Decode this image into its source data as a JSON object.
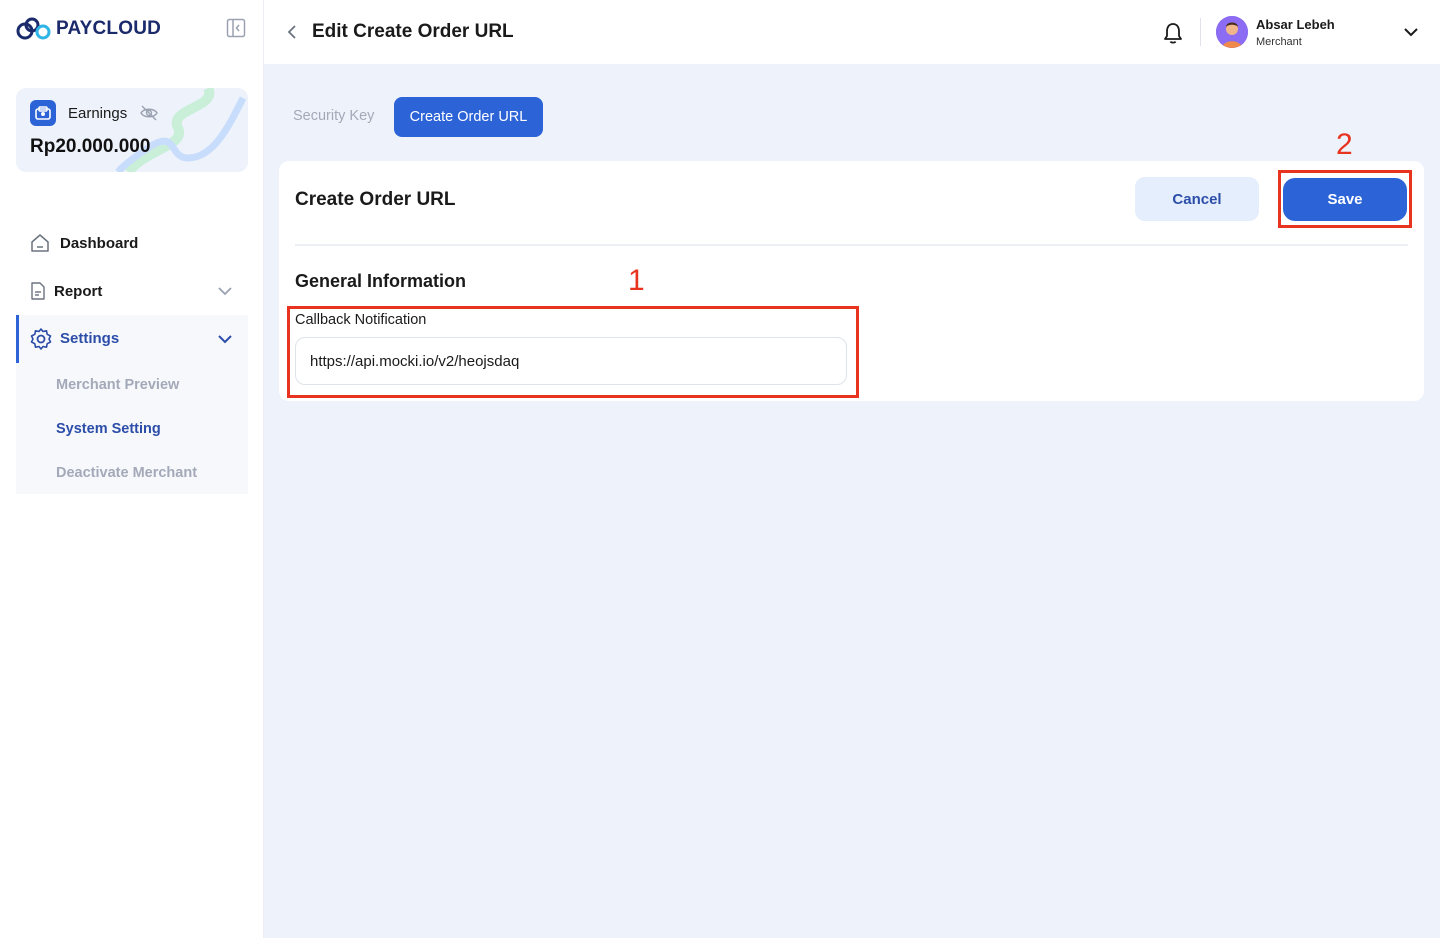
{
  "app": {
    "brand": "PAYCLOUD"
  },
  "earnings": {
    "label": "Earnings",
    "amount": "Rp20.000.000"
  },
  "sidebar": {
    "items": [
      {
        "label": "Dashboard",
        "icon": "home-icon"
      },
      {
        "label": "Report",
        "icon": "document-icon"
      },
      {
        "label": "Settings",
        "icon": "gear-icon"
      }
    ],
    "settings_sub": [
      {
        "label": "Merchant Preview"
      },
      {
        "label": "System Setting",
        "active": true
      },
      {
        "label": "Deactivate Merchant"
      }
    ]
  },
  "header": {
    "title": "Edit Create Order URL",
    "user_name": "Absar Lebeh",
    "user_role": "Merchant"
  },
  "tabs": [
    {
      "label": "Security Key"
    },
    {
      "label": "Create Order URL",
      "active": true
    }
  ],
  "card": {
    "title": "Create Order URL",
    "cancel_label": "Cancel",
    "save_label": "Save",
    "section_title": "General Information",
    "field_label": "Callback Notification",
    "field_value": "https://api.mocki.io/v2/heojsdaq"
  },
  "annotations": {
    "one": "1",
    "two": "2"
  },
  "colors": {
    "accent": "#2c64d8",
    "annotation": "#e8331f",
    "background": "#eef2fa"
  }
}
